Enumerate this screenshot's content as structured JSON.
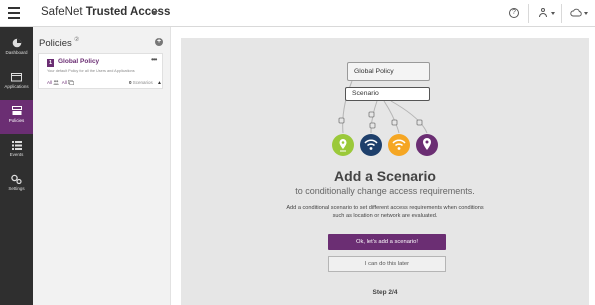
{
  "app": {
    "title_regular": "SafeNet ",
    "title_bold": "Trusted Access"
  },
  "topbar": {
    "help_icon": "help-circle-icon",
    "user_icon": "user-icon",
    "cloud_icon": "cloud-icon",
    "help_glyph": "?"
  },
  "sidebar": {
    "items": [
      {
        "label": "Dashboard",
        "icon": "pie-chart-icon",
        "active": false
      },
      {
        "label": "Applications",
        "icon": "window-icon",
        "active": false
      },
      {
        "label": "Policies",
        "icon": "policies-icon",
        "active": true
      },
      {
        "label": "Events",
        "icon": "list-icon",
        "active": false
      },
      {
        "label": "Settings",
        "icon": "gear-icon",
        "active": false
      }
    ]
  },
  "policies": {
    "title": "Policies",
    "info_glyph": "②",
    "add_glyph": "+",
    "card": {
      "priority": "1",
      "name": "Global Policy",
      "menu": "•••",
      "description": "Your default Policy for all the Users and Applications",
      "users": "All",
      "apps": "All",
      "scenario_count": "0",
      "scenario_label": "Scenarios",
      "collapse_glyph": "▲"
    }
  },
  "wizard": {
    "node_global": "Global Policy",
    "node_scenario": "Scenario",
    "title": "Add a Scenario",
    "subtitle": "to conditionally change access requirements.",
    "description": "Add a conditional scenario to set different access requirements when conditions such as location or network are evaluated.",
    "primary_button": "Ok, let's add a scenario!",
    "secondary_button": "I can do this later",
    "step": "Step 2/4",
    "icon_colors": [
      "#9bc93a",
      "#1e3f6b",
      "#f5a623",
      "#6b2e73"
    ]
  }
}
